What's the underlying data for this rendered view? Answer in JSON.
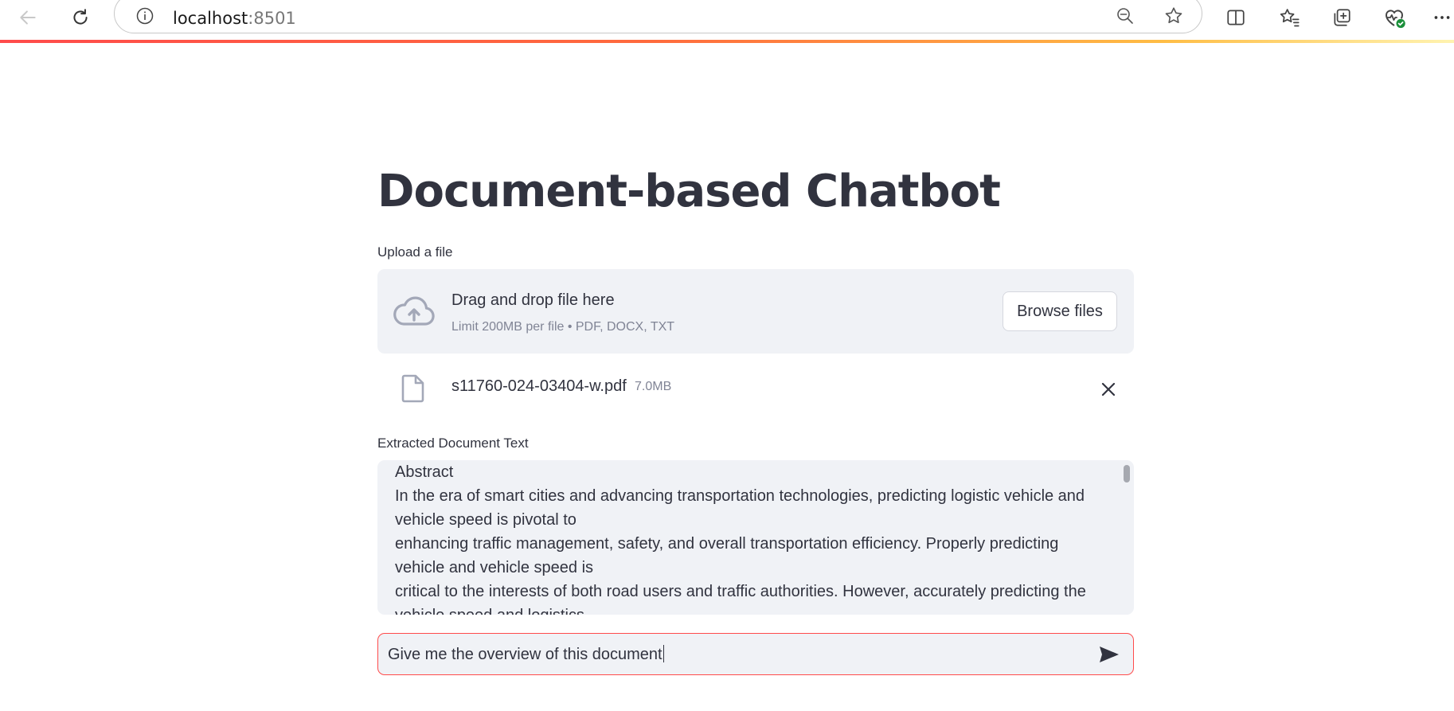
{
  "browser": {
    "url_host": "localhost",
    "url_port": ":8501"
  },
  "app": {
    "title": "Document-based Chatbot",
    "uploader": {
      "label": "Upload a file",
      "drop_title": "Drag and drop file here",
      "drop_subtitle": "Limit 200MB per file • PDF, DOCX, TXT",
      "browse_label": "Browse files"
    },
    "uploaded_file": {
      "name": "s11760-024-03404-w.pdf",
      "size": "7.0MB"
    },
    "extracted": {
      "label": "Extracted Document Text",
      "text": "Abstract\nIn the era of smart cities and advancing transportation technologies, predicting logistic vehicle and vehicle speed is pivotal to\nenhancing traffic management, safety, and overall transportation efficiency. Properly predicting vehicle and vehicle speed is\ncritical to the interests of both road users and traffic authorities. However, accurately predicting the vehicle speed and logistics"
    },
    "chat": {
      "value": "Give me the overview of this document"
    }
  },
  "colors": {
    "accent": "#ff4b4b",
    "text": "#31333f",
    "muted": "#808495",
    "widget_bg": "#f0f2f6",
    "icon": "#a3a8b8"
  }
}
